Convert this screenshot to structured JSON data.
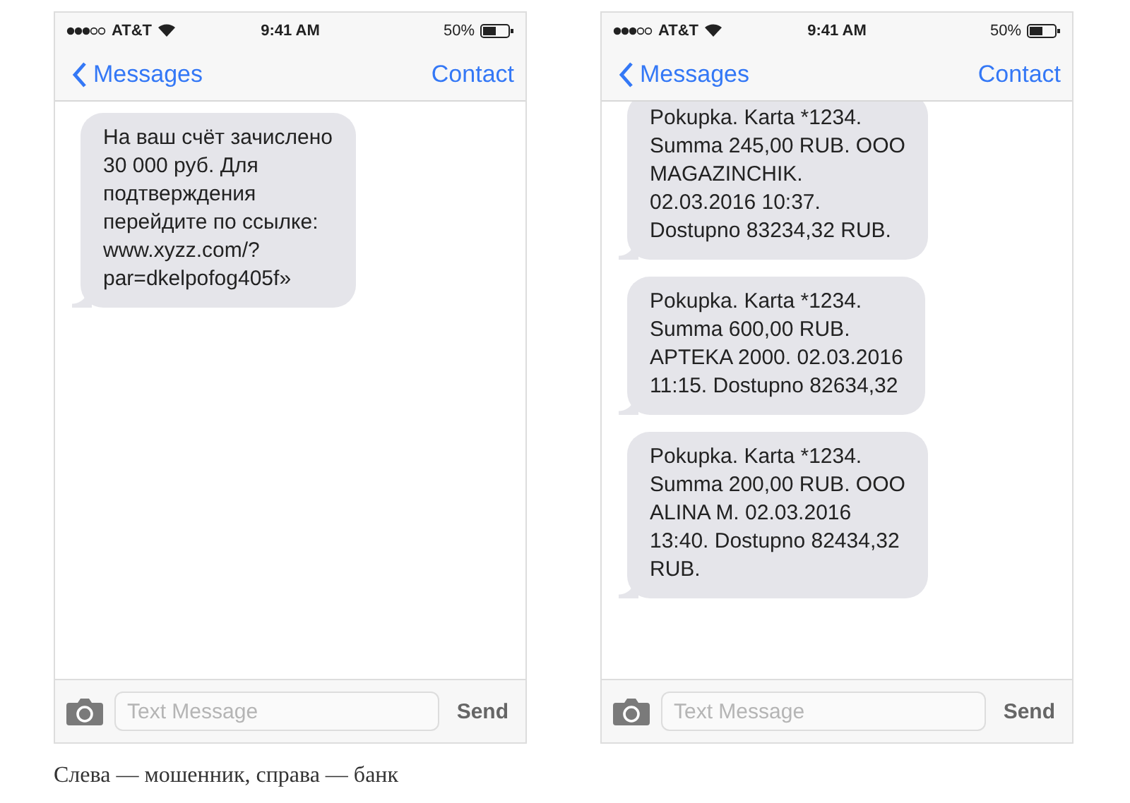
{
  "phones": [
    {
      "status": {
        "carrier": "AT&T",
        "time": "9:41 AM",
        "battery": "50%"
      },
      "nav": {
        "back": "Messages",
        "action": "Contact"
      },
      "messages": [
        {
          "clipped_top": false,
          "text": "На ваш счёт зачислено\n30 000 руб. Для\nподтверждения\nперейдите по ссылке:\nwww.xyzz.com/?\npar=dkelpofog405f»"
        }
      ],
      "composer": {
        "placeholder": "Text Message",
        "send": "Send"
      }
    },
    {
      "status": {
        "carrier": "AT&T",
        "time": "9:41 AM",
        "battery": "50%"
      },
      "nav": {
        "back": "Messages",
        "action": "Contact"
      },
      "messages": [
        {
          "clipped_top": true,
          "text": "Pokupka. Karta *1234.\nSumma 245,00 RUB. OOO\nMAGAZINCHIK.\n02.03.2016 10:37.\nDostupno 83234,32 RUB."
        },
        {
          "clipped_top": false,
          "text": "Pokupka. Karta *1234.\nSumma 600,00 RUB.\nAPTEKA 2000. 02.03.2016\n11:15. Dostupno 82634,32"
        },
        {
          "clipped_top": false,
          "text": "Pokupka. Karta *1234.\nSumma 200,00 RUB. OOO\nALINA M. 02.03.2016\n13:40. Dostupno 82434,32\nRUB."
        }
      ],
      "composer": {
        "placeholder": "Text Message",
        "send": "Send"
      }
    }
  ],
  "caption": "Слева — мошенник, справа — банк"
}
